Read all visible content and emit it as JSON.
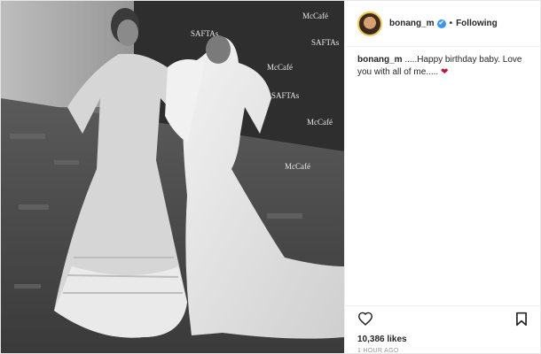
{
  "post": {
    "username": "bonang_m",
    "follow_status": "Following",
    "separator": "•",
    "verified_mark": "✔",
    "caption_text": ".....Happy birthday baby. Love you with all of me.....",
    "caption_emoji": "❤",
    "likes": "10,386 likes",
    "timestamp": "1 HOUR AGO"
  },
  "photo": {
    "backdrop_logo": "McCafé",
    "backdrop_text": "SAFTAs"
  },
  "icons": {
    "like": "heart-outline-icon",
    "save": "bookmark-icon",
    "verified": "verified-badge-icon"
  },
  "colors": {
    "accent": "#3897f0",
    "text": "#262626",
    "muted": "#999999",
    "emoji": "#c0183a"
  }
}
